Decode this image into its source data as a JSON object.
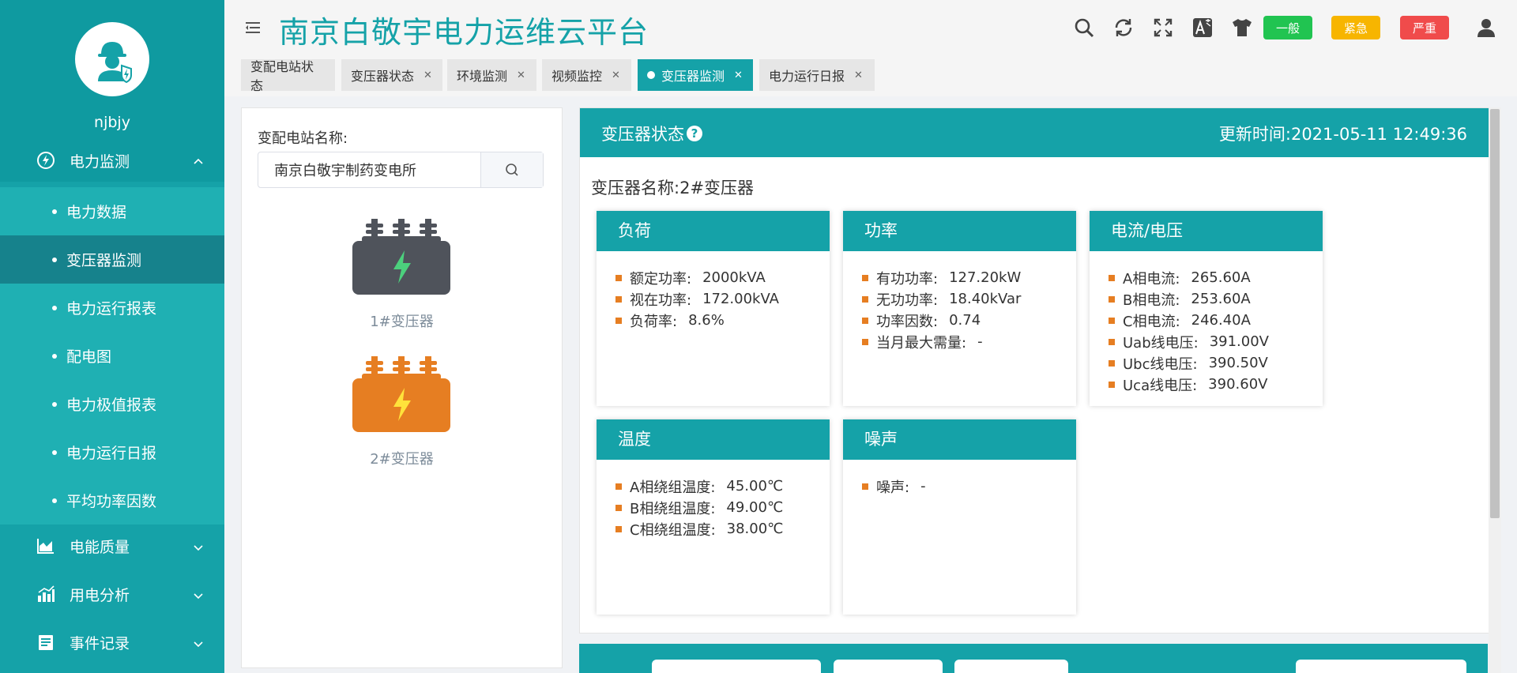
{
  "user": {
    "name": "njbjy"
  },
  "header": {
    "title": "南京白敬宇电力运维云平台",
    "alarm_general": "一般",
    "alarm_urgent": "紧急",
    "alarm_serious": "严重"
  },
  "sidebar": {
    "group_power": "电力监测",
    "sub_items": [
      "电力数据",
      "变压器监测",
      "电力运行报表",
      "配电图",
      "电力极值报表",
      "电力运行日报",
      "平均功率因数"
    ],
    "group_quality": "电能质量",
    "group_analysis": "用电分析",
    "group_events": "事件记录"
  },
  "tabs": [
    "变配电站状态",
    "变压器状态",
    "环境监测",
    "视频监控",
    "变压器监测",
    "电力运行日报"
  ],
  "left": {
    "station_label": "变配电站名称:",
    "station_value": "南京白敬宇制药变电所",
    "transformers": [
      "1#变压器",
      "2#变压器"
    ]
  },
  "status": {
    "title": "变压器状态",
    "update_label": "更新时间:",
    "update_time": "2021-05-11 12:49:36",
    "name_label": "变压器名称:",
    "name_value": "2#变压器"
  },
  "cards": {
    "load": {
      "title": "负荷",
      "rows": [
        {
          "k": "额定功率:",
          "v": "2000kVA"
        },
        {
          "k": "视在功率:",
          "v": "172.00kVA"
        },
        {
          "k": "负荷率:",
          "v": "8.6%"
        }
      ]
    },
    "power": {
      "title": "功率",
      "rows": [
        {
          "k": "有功功率:",
          "v": "127.20kW"
        },
        {
          "k": "无功功率:",
          "v": "18.40kVar"
        },
        {
          "k": "功率因数:",
          "v": "0.74"
        },
        {
          "k": "当月最大需量:",
          "v": "-"
        }
      ]
    },
    "cv": {
      "title": "电流/电压",
      "rows": [
        {
          "k": "A相电流:",
          "v": "265.60A"
        },
        {
          "k": "B相电流:",
          "v": "253.60A"
        },
        {
          "k": "C相电流:",
          "v": "246.40A"
        },
        {
          "k": "Uab线电压:",
          "v": "391.00V"
        },
        {
          "k": "Ubc线电压:",
          "v": "390.50V"
        },
        {
          "k": "Uca线电压:",
          "v": "390.60V"
        }
      ]
    },
    "temp": {
      "title": "温度",
      "rows": [
        {
          "k": "A相绕组温度:",
          "v": "45.00℃"
        },
        {
          "k": "B相绕组温度:",
          "v": "49.00℃"
        },
        {
          "k": "C相绕组温度:",
          "v": "38.00℃"
        }
      ]
    },
    "noise": {
      "title": "噪声",
      "rows": [
        {
          "k": "噪声:",
          "v": "-"
        }
      ]
    }
  },
  "colors": {
    "accent": "#15a2a8",
    "active_sub": "#16828c",
    "general": "#21c451",
    "urgent": "#f7b500",
    "serious": "#f04b4b",
    "bullet": "#e67e22"
  }
}
